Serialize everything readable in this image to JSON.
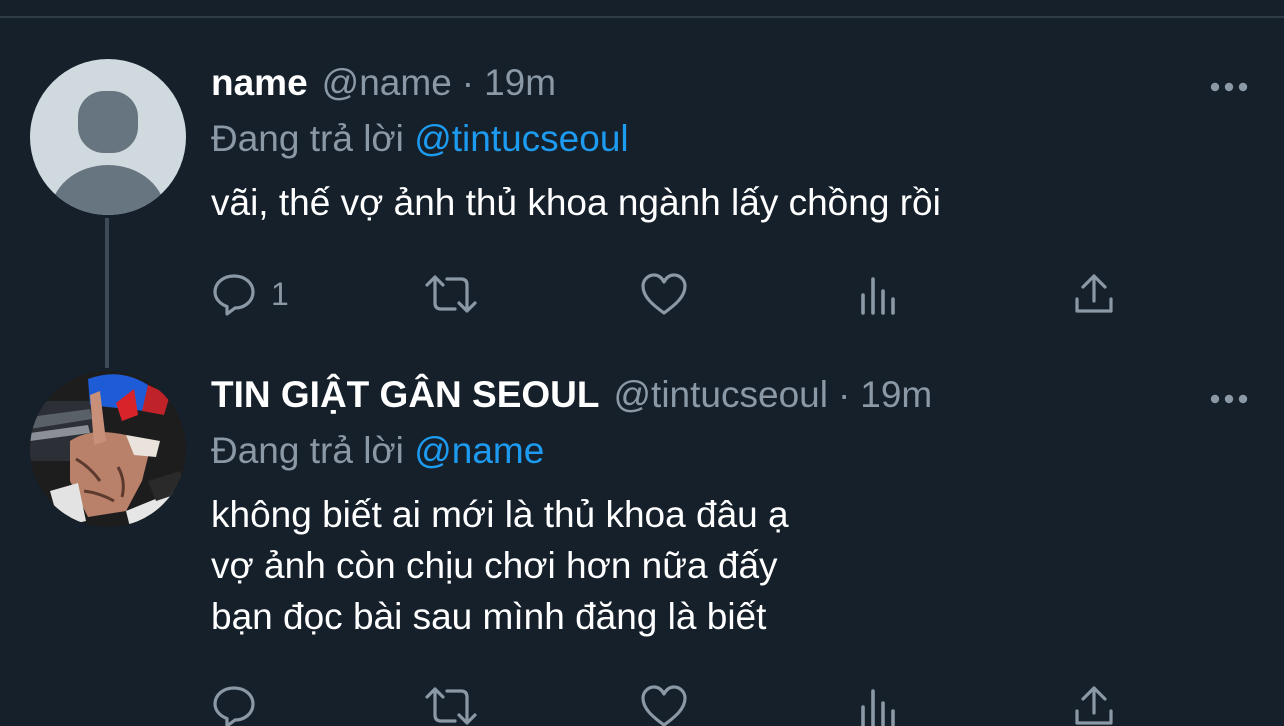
{
  "tweets": [
    {
      "display_name": "name",
      "handle": "@name",
      "separator": "·",
      "time": "19m",
      "reply_prefix": "Đang trả lời",
      "reply_to": "@tintucseoul",
      "text_lines": [
        "vãi, thế vợ ảnh thủ khoa ngành lấy chồng rồi"
      ],
      "reply_count": "1",
      "avatar": "default-avatar"
    },
    {
      "display_name": "TIN GIẬT GÂN SEOUL",
      "handle": "@tintucseoul",
      "separator": "·",
      "time": "19m",
      "reply_prefix": "Đang trả lời",
      "reply_to": "@name",
      "text_lines": [
        "không biết ai mới là thủ khoa đâu ạ",
        "vợ ảnh còn chịu chơi hơn nữa đấy",
        "bạn đọc bài sau mình đăng là biết"
      ],
      "reply_count": "",
      "avatar": "photo-avatar"
    }
  ],
  "icons": {
    "more": "more-horizontal-icon",
    "reply": "reply-bubble-icon",
    "retweet": "retweet-icon",
    "like": "heart-icon",
    "analytics": "analytics-bars-icon",
    "share": "share-upload-icon"
  },
  "colors": {
    "background": "#15202b",
    "link": "#1d9bf0",
    "muted": "#8b98a5",
    "text": "#ffffff",
    "thread_line": "#3d4b59"
  }
}
